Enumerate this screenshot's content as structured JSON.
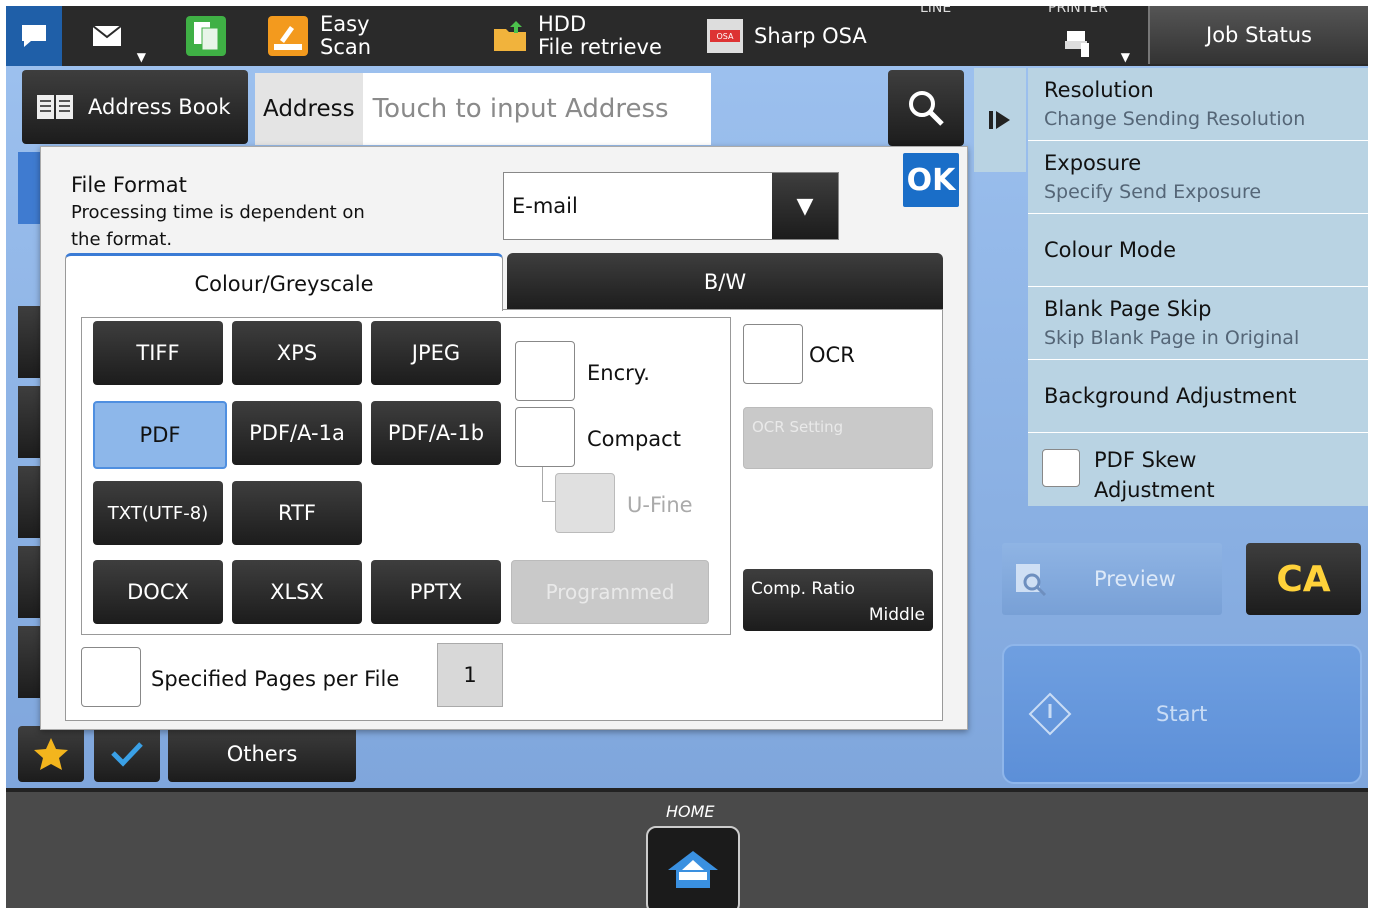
{
  "topbar": {
    "easy_scan_line1": "Easy",
    "easy_scan_line2": "Scan",
    "hdd_line1": "HDD",
    "hdd_line2": "File retrieve",
    "sharp_osa": "Sharp OSA",
    "line_label": "LINE",
    "printer_label": "PRINTER",
    "job_status": "Job Status"
  },
  "address": {
    "book_label": "Address Book",
    "field_label": "Address",
    "placeholder": "Touch to input Address"
  },
  "right_menu": {
    "items": [
      {
        "title": "Resolution",
        "subtitle": "Change Sending Resolution"
      },
      {
        "title": "Exposure",
        "subtitle": "Specify Send Exposure"
      },
      {
        "title": "Colour Mode",
        "subtitle": ""
      },
      {
        "title": "Blank Page Skip",
        "subtitle": "Skip Blank Page in Original"
      },
      {
        "title": "Background Adjustment",
        "subtitle": ""
      }
    ],
    "pdf_skew_line1": "PDF Skew",
    "pdf_skew_line2": "Adjustment"
  },
  "actions": {
    "preview": "Preview",
    "ca": "CA",
    "start": "Start",
    "others": "Others"
  },
  "dialog": {
    "ok": "OK",
    "title": "File Format",
    "note": "Processing time is dependent on the format.",
    "select_value": "E-mail",
    "tabs": [
      "Colour/Greyscale",
      "B/W"
    ],
    "formats": [
      "TIFF",
      "XPS",
      "JPEG",
      "PDF",
      "PDF/A-1a",
      "PDF/A-1b",
      "TXT(UTF-8)",
      "RTF",
      "DOCX",
      "XLSX",
      "PPTX"
    ],
    "selected_format": "PDF",
    "programmed": "Programmed",
    "encry": "Encry.",
    "compact": "Compact",
    "ufine": "U-Fine",
    "ocr": "OCR",
    "ocr_setting": "OCR Setting",
    "comp_ratio_label": "Comp. Ratio",
    "comp_ratio_value": "Middle",
    "pages_label": "Specified Pages per File",
    "pages_value": "1"
  },
  "home": {
    "label": "HOME"
  },
  "colors": {
    "accent_blue": "#1a6ec8",
    "selected_format": "#8db7ea",
    "ca_yellow": "#ffd23a",
    "background": "#8db4e6"
  }
}
